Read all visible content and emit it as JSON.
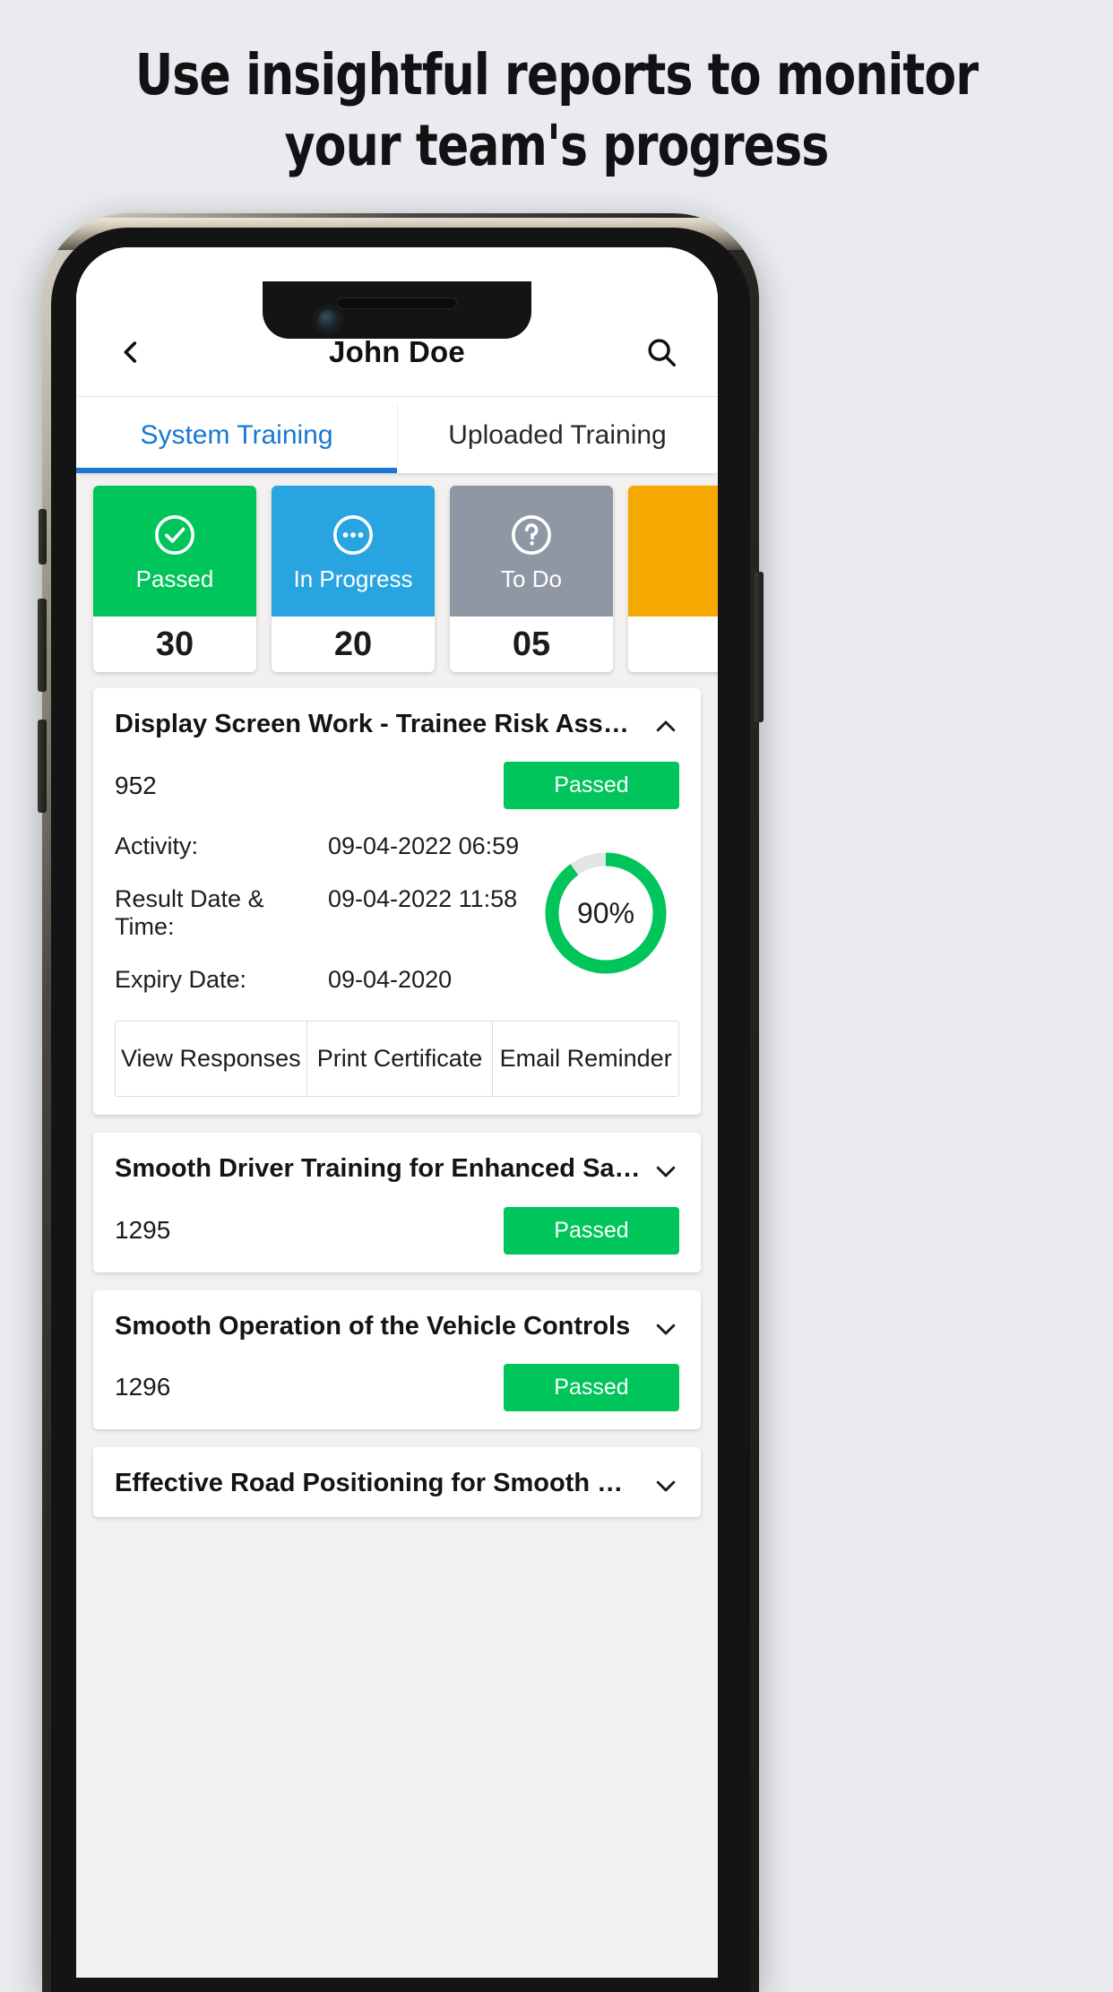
{
  "promo": {
    "heading_line1": "Use insightful reports to monitor",
    "heading_line2": "your team's progress"
  },
  "app": {
    "header": {
      "back_icon": "chevron-left-icon",
      "title": "John Doe",
      "search_icon": "search-icon"
    },
    "tabs": [
      {
        "label": "System Training",
        "active": true
      },
      {
        "label": "Uploaded Training",
        "active": false
      }
    ],
    "status_cards": [
      {
        "label": "Passed",
        "count": "30",
        "color": "#00c55a",
        "icon": "check-circle-icon"
      },
      {
        "label": "In Progress",
        "count": "20",
        "color": "#28a4e0",
        "icon": "ellipsis-circle-icon"
      },
      {
        "label": "To Do",
        "count": "05",
        "color": "#8e97a3",
        "icon": "question-circle-icon"
      },
      {
        "label": "",
        "count": "",
        "color": "#f5a800",
        "icon": ""
      }
    ],
    "expanded_item": {
      "title": "Display Screen Work - Trainee Risk Assessment",
      "chevron_icon": "chevron-up-icon",
      "code": "952",
      "status": "Passed",
      "status_color": "#00c55a",
      "rows": [
        {
          "label": "Activity:",
          "value": "09-04-2022 06:59"
        },
        {
          "label": "Result Date & Time:",
          "value": "09-04-2022 11:58"
        },
        {
          "label": "Expiry Date:",
          "value": "09-04-2020"
        }
      ],
      "progress_percent": 90,
      "progress_label": "90%",
      "progress_color": "#00c55a",
      "progress_track_color": "#e4e4e4",
      "actions": [
        "View Responses",
        "Print Certificate",
        "Email Reminder"
      ]
    },
    "collapsed_items": [
      {
        "title": "Smooth Driver Training for Enhanced Safety an…",
        "chevron_icon": "chevron-down-icon",
        "code": "1295",
        "status": "Passed",
        "status_color": "#00c55a"
      },
      {
        "title": "Smooth Operation of the Vehicle Controls",
        "chevron_icon": "chevron-down-icon",
        "code": "1296",
        "status": "Passed",
        "status_color": "#00c55a"
      },
      {
        "title": "Effective Road Positioning for Smooth Driving",
        "chevron_icon": "chevron-down-icon",
        "code": "",
        "status": "",
        "status_color": "#00c55a"
      }
    ]
  }
}
